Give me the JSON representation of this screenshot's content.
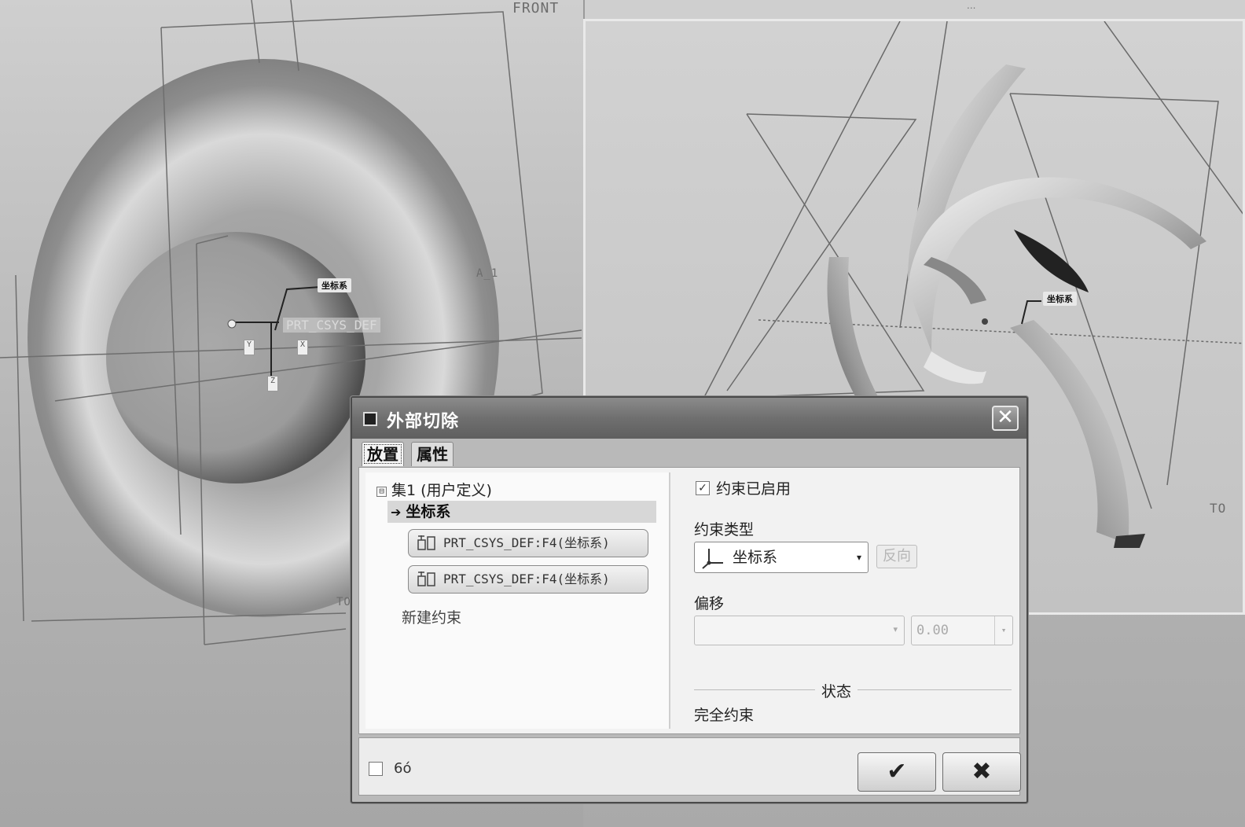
{
  "viewports": {
    "left": {
      "plane_labels": [
        "FRONT",
        "A_1",
        "TO"
      ],
      "tag": "坐标系",
      "csys_label": "PRT_CSYS_DEF",
      "axis_labels": [
        "Y",
        "X",
        "Z"
      ]
    },
    "right": {
      "plane_labels": [
        "TO"
      ],
      "tag": "坐标系",
      "top_strip_text": "..."
    }
  },
  "dialog": {
    "title": "外部切除",
    "close_label": "✕",
    "tabs": [
      {
        "label": "放置",
        "active": true
      },
      {
        "label": "属性",
        "active": false
      }
    ],
    "tree": {
      "root_toggle": "⊟",
      "root_label": "集1 (用户定义)",
      "selected_node": "坐标系",
      "references": [
        "PRT_CSYS_DEF:F4(坐标系)",
        "PRT_CSYS_DEF:F4(坐标系)"
      ],
      "new_constraint": "新建约束"
    },
    "constraint_enabled": {
      "label": "约束已启用",
      "checked": true,
      "mark": "✓"
    },
    "constraint_type": {
      "label": "约束类型",
      "value": "坐标系",
      "caret": "▾",
      "flip_label": "反向"
    },
    "offset": {
      "label": "偏移",
      "select_value": "",
      "caret": "▾",
      "value": "0.00"
    },
    "status": {
      "heading": "状态",
      "text": "完全约束"
    },
    "footer": {
      "preview_icon": "6ó",
      "ok_label": "✔",
      "cancel_label": "✖"
    }
  }
}
